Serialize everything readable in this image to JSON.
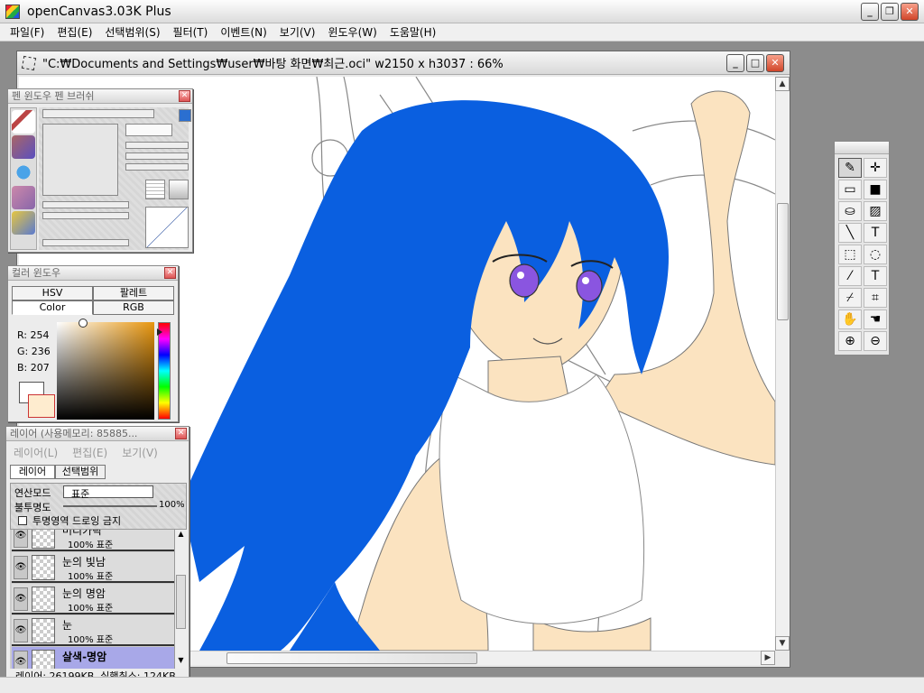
{
  "app": {
    "title": "openCanvas3.03K Plus"
  },
  "menu": [
    "파일(F)",
    "편집(E)",
    "선택범위(S)",
    "필터(T)",
    "이벤트(N)",
    "보기(V)",
    "윈도우(W)",
    "도움말(H)"
  ],
  "document": {
    "title": "\"C:₩Documents and Settings₩user₩바탕 화면₩최근.oci\" w2150 x h3037 : 66%"
  },
  "pen_window": {
    "title": "펜 윈도우  펜 브러쉬"
  },
  "color_window": {
    "title": "컬러 윈도우",
    "tabs": [
      "HSV",
      "팔레트",
      "Color",
      "RGB"
    ],
    "r": "R: 254",
    "g": "G: 236",
    "b": "B: 207",
    "fg": "#ffffff",
    "bg": "#feeccf"
  },
  "layer_window": {
    "title": "레이어 (사용메모리: 85885...",
    "menu": [
      "레이어(L)",
      "편집(E)",
      "보기(V)"
    ],
    "tabs": [
      "레이어",
      "선택범위"
    ],
    "blend_label": "연산모드",
    "blend_value": "표준",
    "opacity_label": "불투명도",
    "opacity_value": "100%",
    "protect_label": "투명영역 드로잉 금지",
    "layers": [
      {
        "name": "머리카락",
        "sub": "100% 표준"
      },
      {
        "name": "눈의 빛남",
        "sub": "100% 표준"
      },
      {
        "name": "눈의 명암",
        "sub": "100% 표준"
      },
      {
        "name": "눈",
        "sub": "100% 표준"
      },
      {
        "name": "살색-명암",
        "sub": ""
      }
    ],
    "footer": "레이어: 26199KB, 실행취소: 124KB"
  },
  "colors": {
    "hair": "#0a5fe0",
    "skin": "#fbe3c0",
    "window_close": "#d0452a"
  }
}
